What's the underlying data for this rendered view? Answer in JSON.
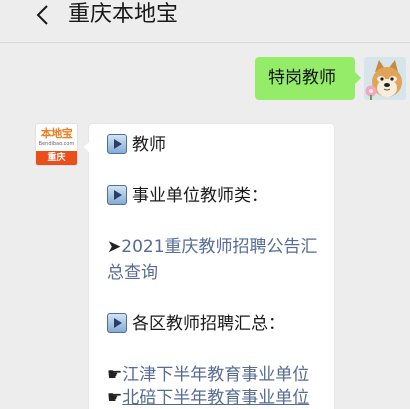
{
  "header": {
    "back_icon": "chevron-left-icon",
    "title": "重庆本地宝"
  },
  "colors": {
    "background": "#ededed",
    "my_bubble": "#95ec69",
    "their_bubble": "#ffffff",
    "link": "#576b95",
    "text": "#191919",
    "brand_orange": "#f07c1b",
    "city_bar": "#e94e1b"
  },
  "my_message": {
    "avatar_icon": "shiba-dog-flower-avatar",
    "text": "特岗教师"
  },
  "account_message": {
    "avatar": {
      "logo_text": "本地宝",
      "logo_subtext": "Bendibao.com",
      "city": "重庆"
    },
    "section_teachers": {
      "icon": "play-button-icon",
      "text": "教师"
    },
    "section_institutions": {
      "icon": "play-button-icon",
      "text": "事业单位教师类："
    },
    "announcement_link": {
      "prefix": "➤",
      "text": "2021重庆教师招聘公告汇总查询"
    },
    "section_districts": {
      "icon": "play-button-icon",
      "text": "各区教师招聘汇总："
    },
    "district_links": [
      {
        "prefix": "☛",
        "text": "江津下半年教育事业单位"
      },
      {
        "prefix": "☛",
        "text": "北碚下半年教育事业单位"
      }
    ]
  }
}
